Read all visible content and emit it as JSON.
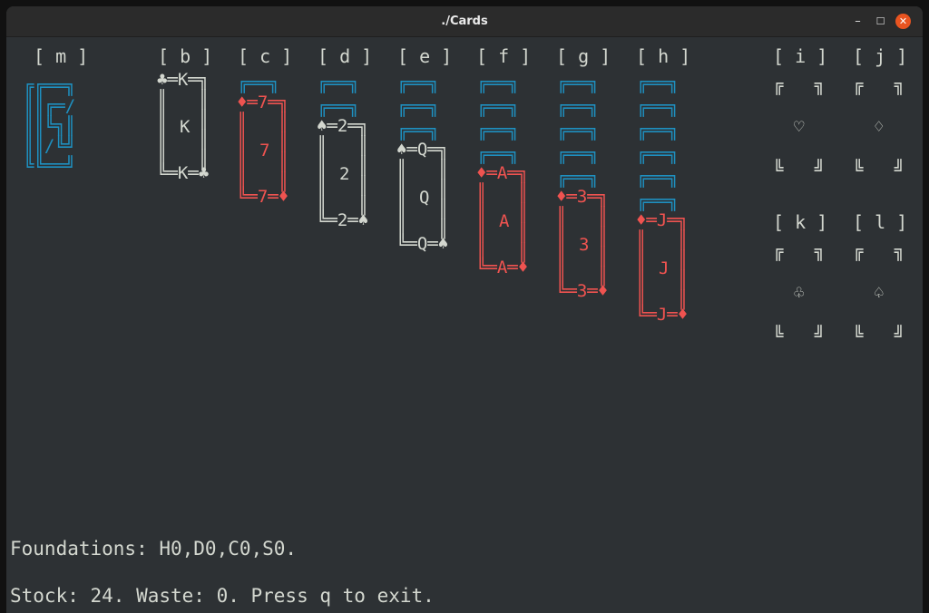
{
  "window": {
    "title": "./Cards",
    "minimize": "–",
    "maximize": "☐",
    "close": "✕"
  },
  "labels": {
    "m": "[ m ]",
    "b": "[ b ]",
    "c": "[ c ]",
    "d": "[ d ]",
    "e": "[ e ]",
    "f": "[ f ]",
    "g": "[ g ]",
    "h": "[ h ]",
    "i": "[ i ]",
    "j": "[ j ]",
    "k": "[ k ]",
    "l": "[ l ]"
  },
  "back": "╔══╗",
  "stock": {
    "l1": "╔╔══╗",
    "l2": "║║╔═/",
    "l3": "║║╚╗║",
    "l4": "║║/╚╝",
    "l5": "╚╚══╝"
  },
  "cards": {
    "b": {
      "top": "♣═K═╗",
      "mid": "K",
      "bot": "╚═K═♣",
      "side": "║   ║"
    },
    "c": {
      "top": "♦═7═╗",
      "mid": "7",
      "bot": "╚═7═♦",
      "side": "║   ║"
    },
    "d": {
      "top": "♠═2═╗",
      "mid": "2",
      "bot": "╚═2═♠",
      "side": "║   ║"
    },
    "e": {
      "top": "♠═Q═╗",
      "mid": "Q",
      "bot": "╚═Q═♠",
      "side": "║   ║"
    },
    "f": {
      "top": "♦═A═╗",
      "mid": "A",
      "bot": "╚═A═♦",
      "side": "║   ║"
    },
    "g": {
      "top": "♦═3═╗",
      "mid": "3",
      "bot": "╚═3═♦",
      "side": "║   ║"
    },
    "h": {
      "top": "♦═J═╗",
      "mid": "J",
      "bot": "╚═J═♦",
      "side": "║   ║"
    }
  },
  "foundations": {
    "top": "╔   ╗",
    "bot": "╚   ╝",
    "i": "♡",
    "j": "♢",
    "k": "♧",
    "l": "♤"
  },
  "status": {
    "foundations": "Foundations: H0,D0,C0,S0.",
    "stock": "Stock: 24. Waste: 0. Press q to exit."
  }
}
